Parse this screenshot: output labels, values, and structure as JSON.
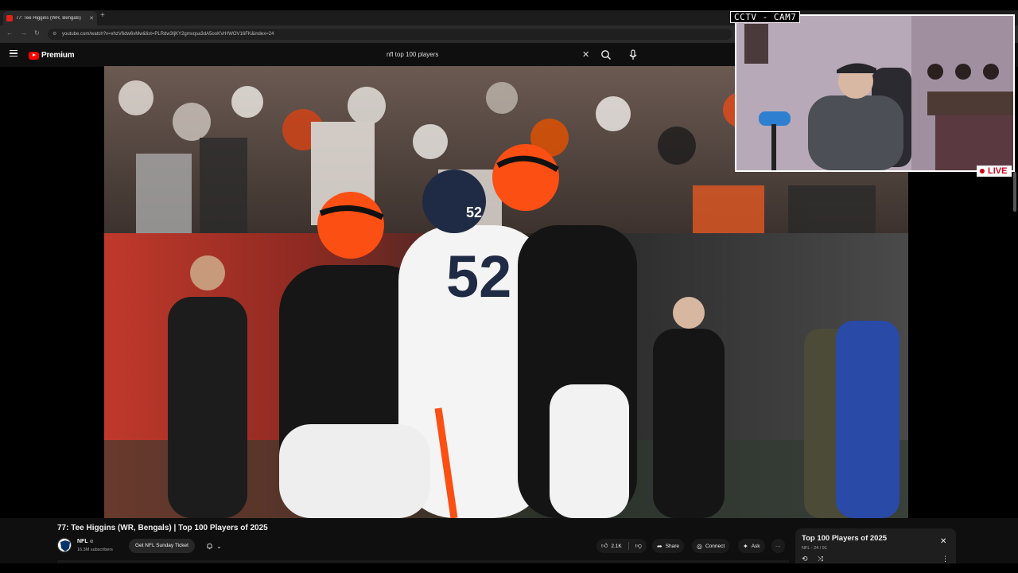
{
  "browser": {
    "tab_title": "77: Tee Higgins (WR, Bengals)",
    "new_tab_symbol": "+",
    "url": "youtube.com/watch?v=xhzV6dw6vMw&list=PLRdw3IjKY2gmvqsa3dA5ooKVrHWOV16FK&index=24",
    "back_icon": "arrow-left-icon",
    "forward_icon": "arrow-right-icon",
    "reload_icon": "reload-icon"
  },
  "youtube": {
    "logo_text": "Premium",
    "search_value": "nfl top 100 players",
    "clear_symbol": "✕"
  },
  "overlay": {
    "cam_label": "CCTV - CAM7",
    "live_label": "LIVE"
  },
  "video": {
    "title": "77: Tee Higgins (WR, Bengals) | Top 100 Players of 2025",
    "channel_name": "NFL",
    "verified_mark": "⊘",
    "subscribers": "16.3M subscribers",
    "ticket_button": "Get NFL Sunday Ticket",
    "likes": "2.1K",
    "share_label": "Share",
    "connect_label": "Connect",
    "ask_label": "Ask",
    "more_symbol": "···"
  },
  "playlist": {
    "title": "Top 100 Players of 2025",
    "meta": "NFL - 24 / 91",
    "close_symbol": "✕"
  },
  "colors": {
    "bengals_orange": "#fb4f14",
    "broncos_navy": "#1f2a44",
    "youtube_red": "#ff0000",
    "live_red": "#d0021b"
  }
}
